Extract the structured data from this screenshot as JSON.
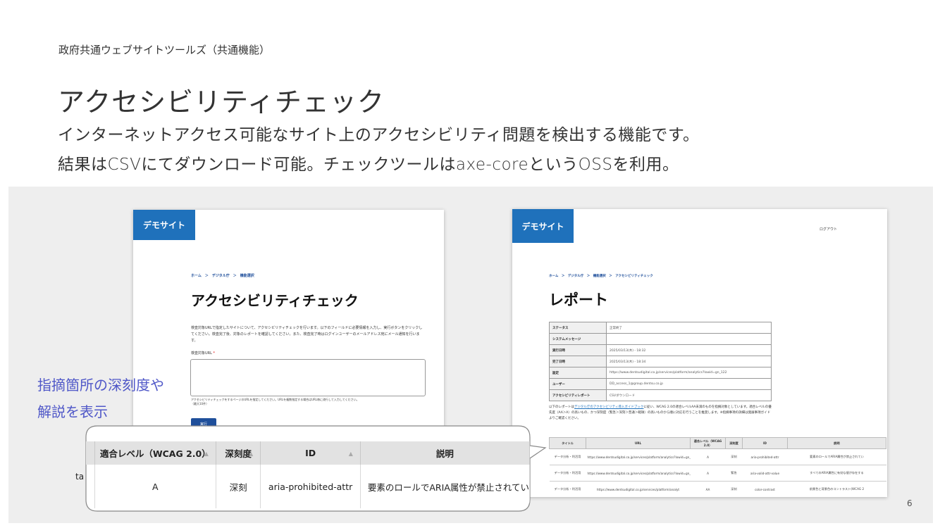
{
  "header": {
    "eyebrow": "政府共通ウェブサイトツールズ（共通機能）",
    "title": "アクセシビリティチェック",
    "desc_line1": "インターネットアクセス可能なサイト上のアクセシビリティ問題を検出する機能です。",
    "desc_line2": "結果はCSVにてダウンロード可能。チェックツールはaxe-coreというOSSを利用。"
  },
  "page_number": "6",
  "callout": {
    "line1": "指摘箇所の深刻度や",
    "line2": "解説を表示"
  },
  "shot_left": {
    "brand": "デモサイト",
    "breadcrumb": "ホーム　＞　デジタル庁　＞　機能選択",
    "heading": "アクセシビリティチェック",
    "body": "検査対象URLで指定したサイトについて、アクセシビリティチェックを行います。以下のフィールドに必要情報を入力し、実行ボタンをクリックしてください。検査完了後、対象のレポートを確認してください。また、検査完了時はログインユーザーのメールアドレス宛にメール通知を行います。",
    "field_label": "検査対象URL",
    "required_mark": "*",
    "hint": "アクセシビリティチェックをするページのURLを指定してください。URLを複数指定する場合はURL毎に改行して入力してください。（最大10件）",
    "run_button": "実行"
  },
  "shot_right": {
    "brand": "デモサイト",
    "logout": "ログアウト",
    "breadcrumb": "ホーム　＞　デジタル庁　＞　機能選択　＞　アクセシビリティチェック",
    "heading": "レポート",
    "kv": [
      {
        "k": "ステータス",
        "v": "正常終了"
      },
      {
        "k": "システムメッセージ",
        "v": ""
      },
      {
        "k": "実行日時",
        "v": "2025/03/13(木) - 18:32"
      },
      {
        "k": "完了日時",
        "v": "2025/03/13(木) - 18:34"
      },
      {
        "k": "設定",
        "v": "https://www.dentsudigital.co.jp/services/platform/analytics?lowid=gn_122"
      },
      {
        "k": "ユーザー",
        "v": "DD_access_1@group.dentsu.co.jp"
      },
      {
        "k": "アクセシビリティレポート",
        "v": "CSVダウンロード"
      }
    ],
    "note_pre": "以下のレポートは",
    "note_link": "デジタル庁のアクセシビリティ導入ガイドブック",
    "note_post": "に従い、WCAG 2.0の適合レベルAA未満のものを指摘対象としています。適合レベルの優先度（AA＞A）の高いもの、かつ深刻度（緊急＞深刻＞普通＞軽微）の高いものから順に対応を行うことを推奨します。※指摘事項の詳細は発展事項ガイドよりご確認ください。",
    "table_headers": [
      "タイトル",
      "URL",
      "適合レベル（WCAG 2.0）",
      "深刻度",
      "ID",
      "説明"
    ],
    "table_rows": [
      [
        "データ分析・利活用",
        "https://www.dentsudigital.co.jp/services/platform/analytics?lowid=gn_122",
        "A",
        "深刻",
        "aria-prohibited-attr",
        "要素のロールでARIA属性が禁止されてい"
      ],
      [
        "データ分析・利活用",
        "https://www.dentsudigital.co.jp/services/platform/analytics?lowid=gn_122",
        "A",
        "緊急",
        "aria-valid-attr-value",
        "すべてのARIA属性に有効な値が存在する"
      ],
      [
        "データ分析・利活用",
        "https://www.dentsudigital.co.jp/services/platform/analyt",
        "AA",
        "深刻",
        "color-contrast",
        "前景色と背景色のコントラスト(WCAG 2"
      ]
    ]
  },
  "zoom": {
    "headers": [
      "",
      "適合レベル（WCAG 2.0）",
      "深刻度",
      "ID",
      "説明"
    ],
    "row": [
      "",
      "A",
      "深刻",
      "aria-prohibited-attr",
      "要素のロールでARIA属性が禁止されてい"
    ],
    "leak_char": "ta"
  }
}
